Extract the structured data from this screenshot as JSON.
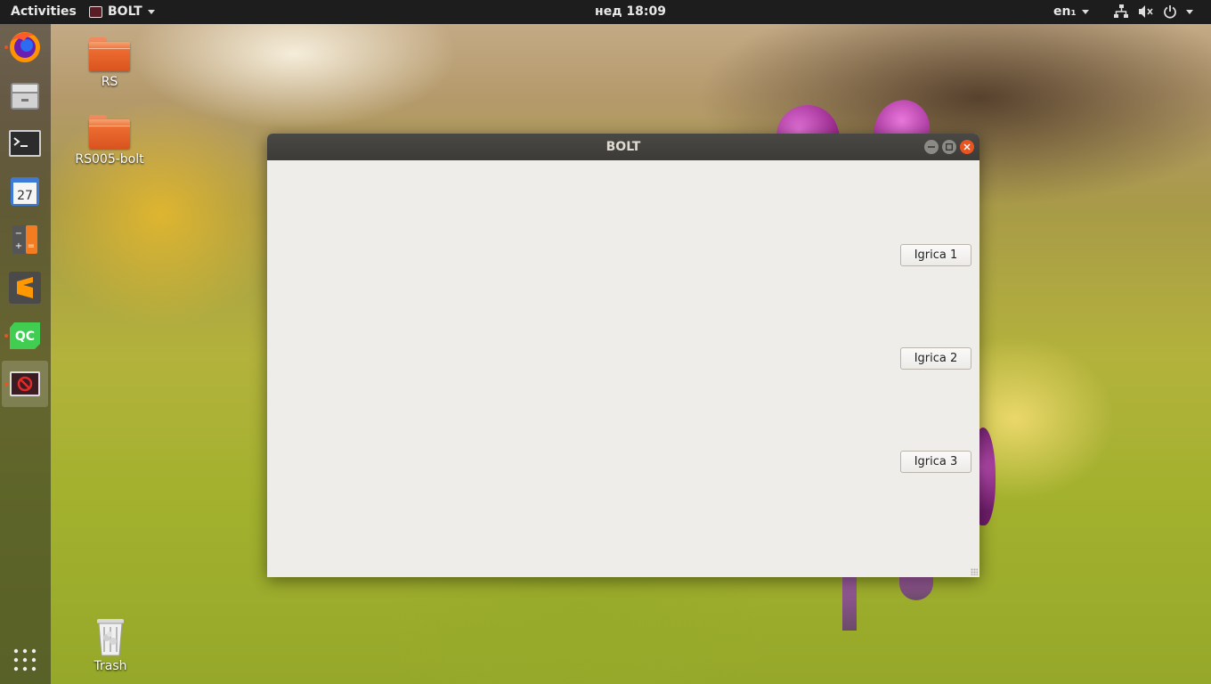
{
  "topbar": {
    "activities": "Activities",
    "app_name": "BOLT",
    "clock": "нед 18:09",
    "language": "en₁"
  },
  "dock": {
    "items": [
      {
        "name": "firefox",
        "running": true
      },
      {
        "name": "files",
        "running": false
      },
      {
        "name": "terminal",
        "running": false
      },
      {
        "name": "calendar",
        "label": "27",
        "running": false
      },
      {
        "name": "calculator",
        "running": false
      },
      {
        "name": "sublime-text",
        "running": false
      },
      {
        "name": "qt-creator",
        "label": "QC",
        "running": true
      },
      {
        "name": "bolt-app",
        "running": true,
        "active": true
      }
    ]
  },
  "desktop": {
    "icons": [
      {
        "label": "RS",
        "icon": "folder-icon"
      },
      {
        "label": "RS005-bolt",
        "icon": "folder-icon"
      },
      {
        "label": "Trash",
        "icon": "trash-icon"
      }
    ]
  },
  "window": {
    "title": "BOLT",
    "buttons": [
      "Igrica 1",
      "Igrica 2",
      "Igrica 3"
    ]
  },
  "colors": {
    "accent": "#e95420",
    "topbar": "#1d1d1d",
    "window_bg": "#efedea",
    "titlebar": "#3c3b37"
  }
}
